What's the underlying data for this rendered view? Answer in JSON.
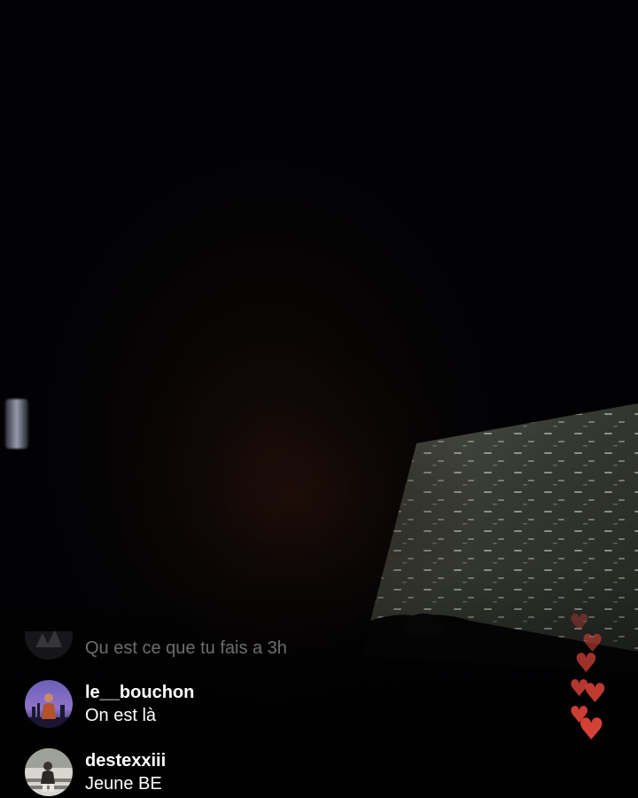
{
  "live_stream": {
    "comments": [
      {
        "username": "",
        "message": "Qu est ce que tu fais a 3h",
        "faded": true
      },
      {
        "username": "le__bouchon",
        "message": "On est là",
        "faded": false
      },
      {
        "username": "destexxiii",
        "message": "Jeune BE",
        "faded": false
      }
    ],
    "reaction_icon": "heart-icon",
    "colors": {
      "background": "#020204",
      "heart": "#e0453a",
      "text": "#ffffff",
      "faded_text": "rgba(255,255,255,0.42)"
    }
  }
}
